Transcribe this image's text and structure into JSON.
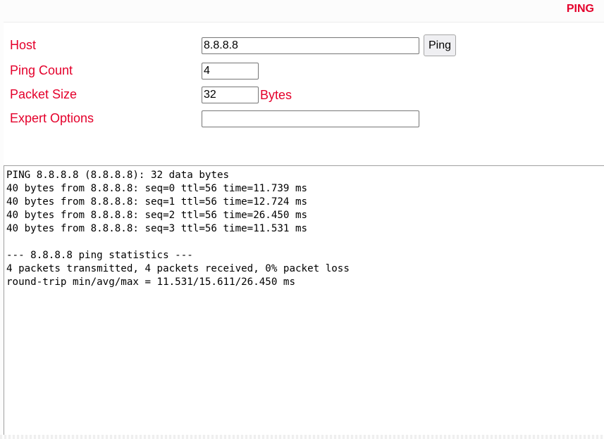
{
  "header": {
    "title": "PING"
  },
  "form": {
    "host": {
      "label": "Host",
      "value": "8.8.8.8",
      "button_label": "Ping"
    },
    "ping_count": {
      "label": "Ping Count",
      "value": "4"
    },
    "packet_size": {
      "label": "Packet Size",
      "value": "32",
      "unit": "Bytes"
    },
    "expert_options": {
      "label": "Expert Options",
      "value": ""
    }
  },
  "output": {
    "text": "PING 8.8.8.8 (8.8.8.8): 32 data bytes\n40 bytes from 8.8.8.8: seq=0 ttl=56 time=11.739 ms\n40 bytes from 8.8.8.8: seq=1 ttl=56 time=12.724 ms\n40 bytes from 8.8.8.8: seq=2 ttl=56 time=26.450 ms\n40 bytes from 8.8.8.8: seq=3 ttl=56 time=11.531 ms\n\n--- 8.8.8.8 ping statistics ---\n4 packets transmitted, 4 packets received, 0% packet loss\nround-trip min/avg/max = 11.531/15.611/26.450 ms"
  },
  "colors": {
    "accent": "#e4002b",
    "background": "#ffffff"
  }
}
